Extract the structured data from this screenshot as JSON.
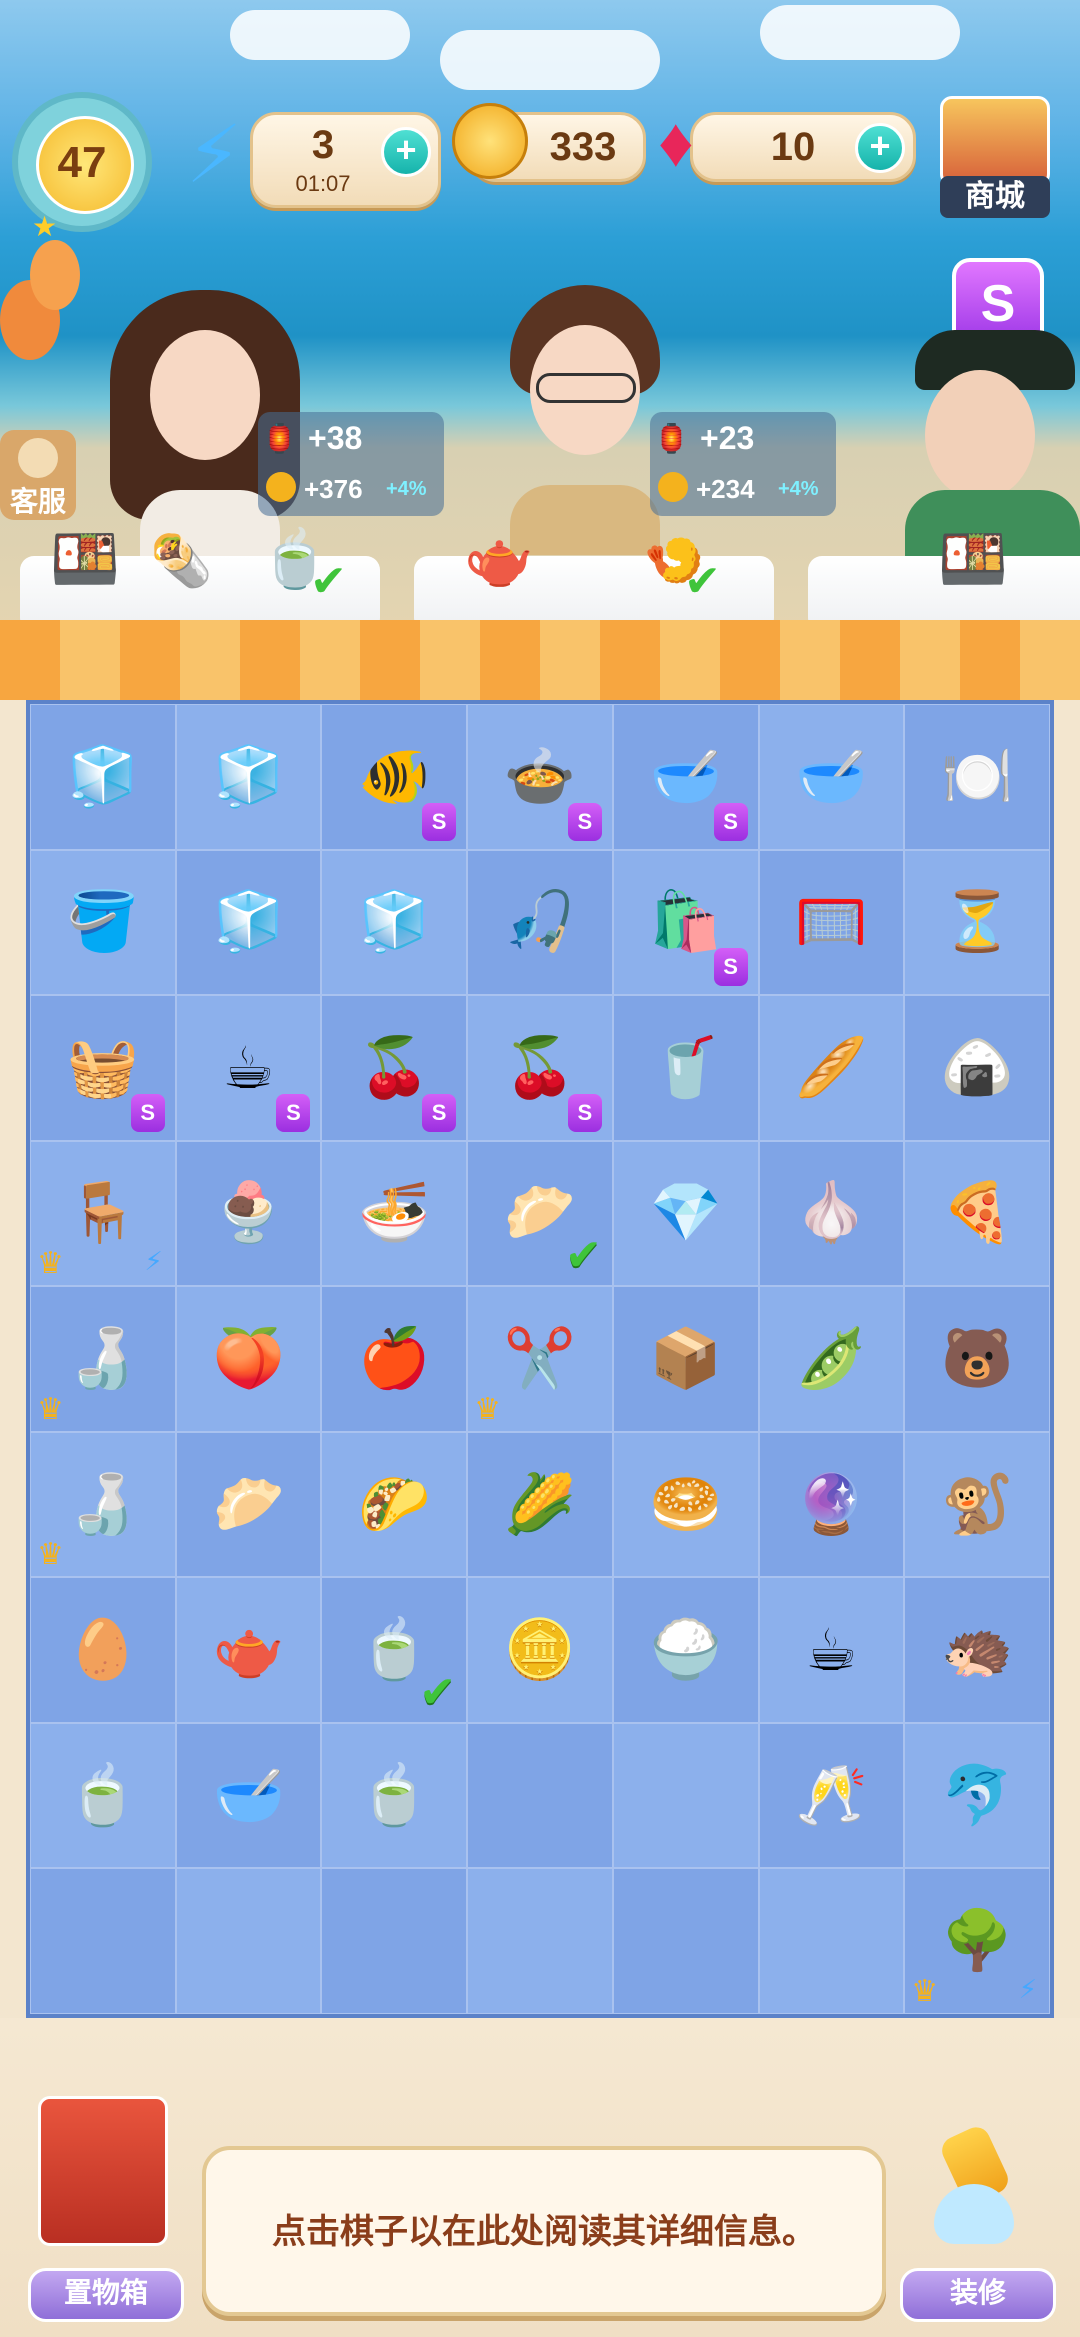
{
  "hud": {
    "level": "47",
    "energy": "3",
    "energy_timer": "01:07",
    "coins": "333",
    "gems": "10",
    "shop_label": "商城"
  },
  "side": {
    "support_label": "客服"
  },
  "customers": [
    {
      "reward_energy": "+38",
      "reward_coins": "+376",
      "bonus": "+4%"
    },
    {
      "reward_energy": "+23",
      "reward_coins": "+234",
      "bonus": "+4%"
    }
  ],
  "board": {
    "rows": [
      [
        "冰箱",
        "冰箱",
        "鱼缸",
        "砂锅",
        "汤碗",
        "瓷碗",
        "瓷盘"
      ],
      [
        "冰桶",
        "冰碗",
        "冰块",
        "鱼竿",
        "纸袋",
        "网兜",
        "沙漏"
      ],
      [
        "篮子",
        "咖啡机",
        "樱桃篮",
        "樱桃盘",
        "榨汁杯",
        "擀面杖",
        "粽子"
      ],
      [
        "茶几",
        "甜点碗",
        "面碗",
        "虾饺",
        "红宝石",
        "压蒜器",
        "披萨"
      ],
      [
        "茶具",
        "桃子",
        "苹果",
        "剪刀",
        "包裹",
        "豌豆",
        "小熊雕像"
      ],
      [
        "茶具",
        "烧卖",
        "卷饼",
        "玉米",
        "包子",
        "水晶球",
        "猴子雕像"
      ],
      [
        "馒头",
        "茶壶",
        "柠檬茶",
        "金币",
        "米碗",
        "茶杯",
        "穿山甲雕像"
      ],
      [
        "柠檬茶",
        "茶汤",
        "盖碗",
        "",
        "",
        "酒杯",
        "海豚雕像"
      ],
      [
        "",
        "",
        "",
        "",
        "",
        "",
        "果树"
      ]
    ]
  },
  "bottom": {
    "storage_label": "置物箱",
    "hint": "点击棋子以在此处阅读其详细信息。",
    "decorate_label": "装修"
  },
  "colors": {
    "board": "#7fa4e6",
    "accent": "#f7a640",
    "check": "#3fc43a"
  }
}
